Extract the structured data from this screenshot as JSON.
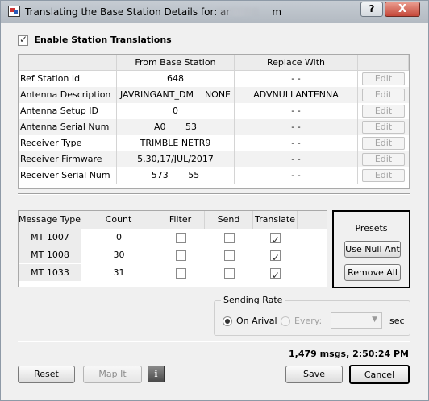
{
  "window": {
    "title": "Translating the Base Station Details for: ar",
    "title_suffix": "m",
    "help_label": "?",
    "close_label": "X"
  },
  "enable": {
    "label": "Enable Station Translations",
    "checked": true
  },
  "details_table": {
    "columns": [
      "",
      "From Base Station",
      "Replace With",
      ""
    ],
    "rows": [
      {
        "name": "Ref Station Id",
        "from": "648",
        "replace": "- -",
        "action": "Edit"
      },
      {
        "name": "Antenna Description",
        "from": "JAVRINGANT_DM    NONE",
        "replace": "ADVNULLANTENNA",
        "action": "Edit"
      },
      {
        "name": "Antenna Setup ID",
        "from": "0",
        "replace": "- -",
        "action": "Edit"
      },
      {
        "name": "Antenna Serial Num",
        "from": "A0       53",
        "replace": "- -",
        "action": "Edit"
      },
      {
        "name": "Receiver Type",
        "from": "TRIMBLE NETR9",
        "replace": "- -",
        "action": "Edit"
      },
      {
        "name": "Receiver Firmware",
        "from": "5.30,17/JUL/2017",
        "replace": "- -",
        "action": "Edit"
      },
      {
        "name": "Receiver Serial Num",
        "from": "573       55",
        "replace": "- -",
        "action": "Edit"
      }
    ]
  },
  "message_table": {
    "columns": [
      "Message Type",
      "Count",
      "Filter",
      "Send",
      "Translate"
    ],
    "rows": [
      {
        "type": "MT 1007",
        "count": "0",
        "filter": false,
        "send": false,
        "translate": true
      },
      {
        "type": "MT 1008",
        "count": "30",
        "filter": false,
        "send": false,
        "translate": true
      },
      {
        "type": "MT 1033",
        "count": "31",
        "filter": false,
        "send": false,
        "translate": true
      }
    ]
  },
  "presets": {
    "title": "Presets",
    "use_null_label": "Use Null Ant",
    "remove_all_label": "Remove All"
  },
  "sending_rate": {
    "legend": "Sending Rate",
    "on_arrival_label": "On Arival",
    "every_label": "Every:",
    "unit": "sec",
    "selected": "On Arival"
  },
  "status": {
    "text": "1,479 msgs,  2:50:24 PM"
  },
  "footer": {
    "reset_label": "Reset",
    "map_it_label": "Map It",
    "info_label": "i",
    "save_label": "Save",
    "cancel_label": "Cancel"
  }
}
